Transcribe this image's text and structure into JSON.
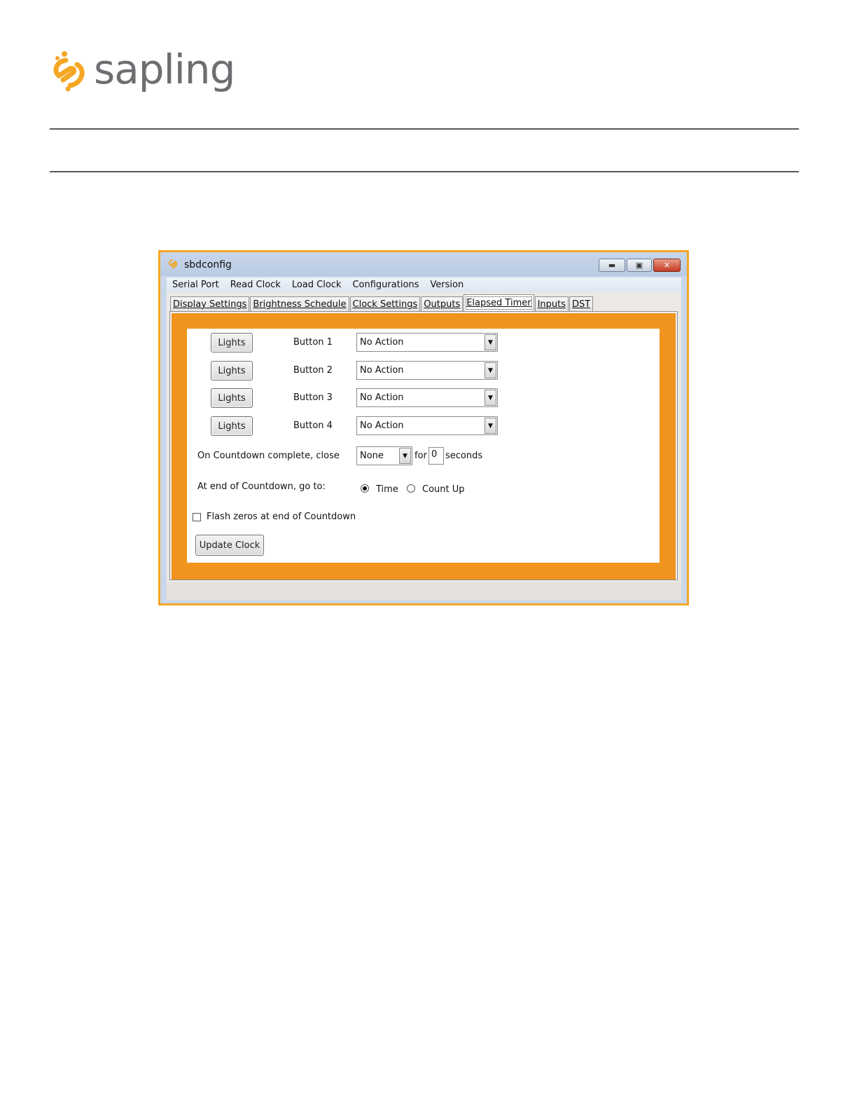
{
  "brand": {
    "name": "sapling",
    "accent_color": "#f5a623",
    "text_color": "#6d6e71"
  },
  "window": {
    "title": "sbdconfig",
    "icon": "sapling-logo-icon",
    "controls": [
      "minimize-icon",
      "maximize-icon",
      "close-icon"
    ]
  },
  "menu": [
    "Serial Port",
    "Read Clock",
    "Load Clock",
    "Configurations",
    "Version"
  ],
  "tabs": [
    "Display Settings",
    "Brightness Schedule",
    "Clock Settings",
    "Outputs",
    "Elapsed Timer",
    "Inputs",
    "DST"
  ],
  "active_tab": "Elapsed Timer",
  "buttons_rows": [
    {
      "lights": "Lights",
      "label": "Button 1",
      "action": "No Action"
    },
    {
      "lights": "Lights",
      "label": "Button 2",
      "action": "No Action"
    },
    {
      "lights": "Lights",
      "label": "Button 3",
      "action": "No Action"
    },
    {
      "lights": "Lights",
      "label": "Button 4",
      "action": "No Action"
    }
  ],
  "countdown_close": {
    "label": "On Countdown complete, close",
    "select_value": "None",
    "for_label": "for",
    "seconds_value": "0",
    "seconds_label": "seconds"
  },
  "end_of_countdown": {
    "label": "At end of Countdown, go to:",
    "options": [
      "Time",
      "Count Up"
    ],
    "selected": "Time"
  },
  "flash_zeros": {
    "label": "Flash zeros at end of Countdown",
    "checked": false
  },
  "update_button": "Update Clock"
}
